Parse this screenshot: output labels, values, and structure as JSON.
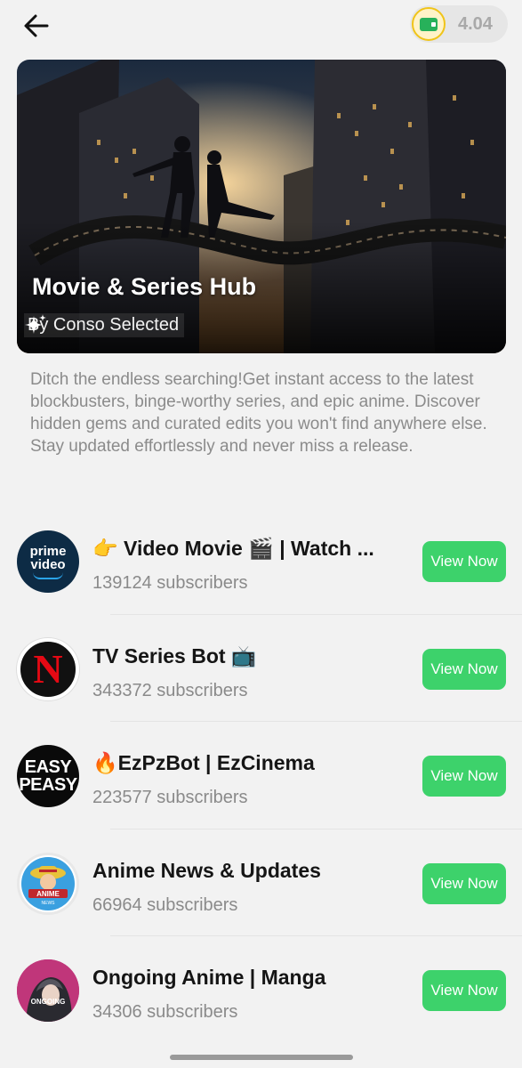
{
  "wallet": {
    "balance": "4.04",
    "icon": "wallet-icon"
  },
  "banner": {
    "title": "Movie & Series Hub",
    "subtitle": "By Conso Selected"
  },
  "description": "Ditch the endless searching!Get instant access to the latest blockbusters, binge-worthy series, and epic anime. Discover hidden gems and curated edits you won't find anywhere else. Stay updated effortlessly and never miss a release.",
  "channels": [
    {
      "name": "👉 Video Movie 🎬 | Watch ...",
      "subscribers": "139124 subscribers",
      "button": "View Now",
      "avatar_text": [
        "prime",
        "video"
      ]
    },
    {
      "name": "TV Series Bot 📺",
      "subscribers": "343372 subscribers",
      "button": "View Now",
      "avatar_text": [
        "N"
      ]
    },
    {
      "name": "🔥EzPzBot | EzCinema",
      "subscribers": "223577 subscribers",
      "button": "View Now",
      "avatar_text": [
        "EASY",
        "PEASY"
      ]
    },
    {
      "name": "Anime News & Updates",
      "subscribers": "66964 subscribers",
      "button": "View Now",
      "avatar_text": [
        "ANIME",
        "NEWS"
      ]
    },
    {
      "name": "Ongoing Anime | Manga",
      "subscribers": "34306 subscribers",
      "button": "View Now",
      "avatar_text": [
        "ONGOING"
      ]
    }
  ],
  "colors": {
    "accent": "#3dd26b",
    "background": "#f2f2f2",
    "muted_text": "#8a8a8a"
  }
}
